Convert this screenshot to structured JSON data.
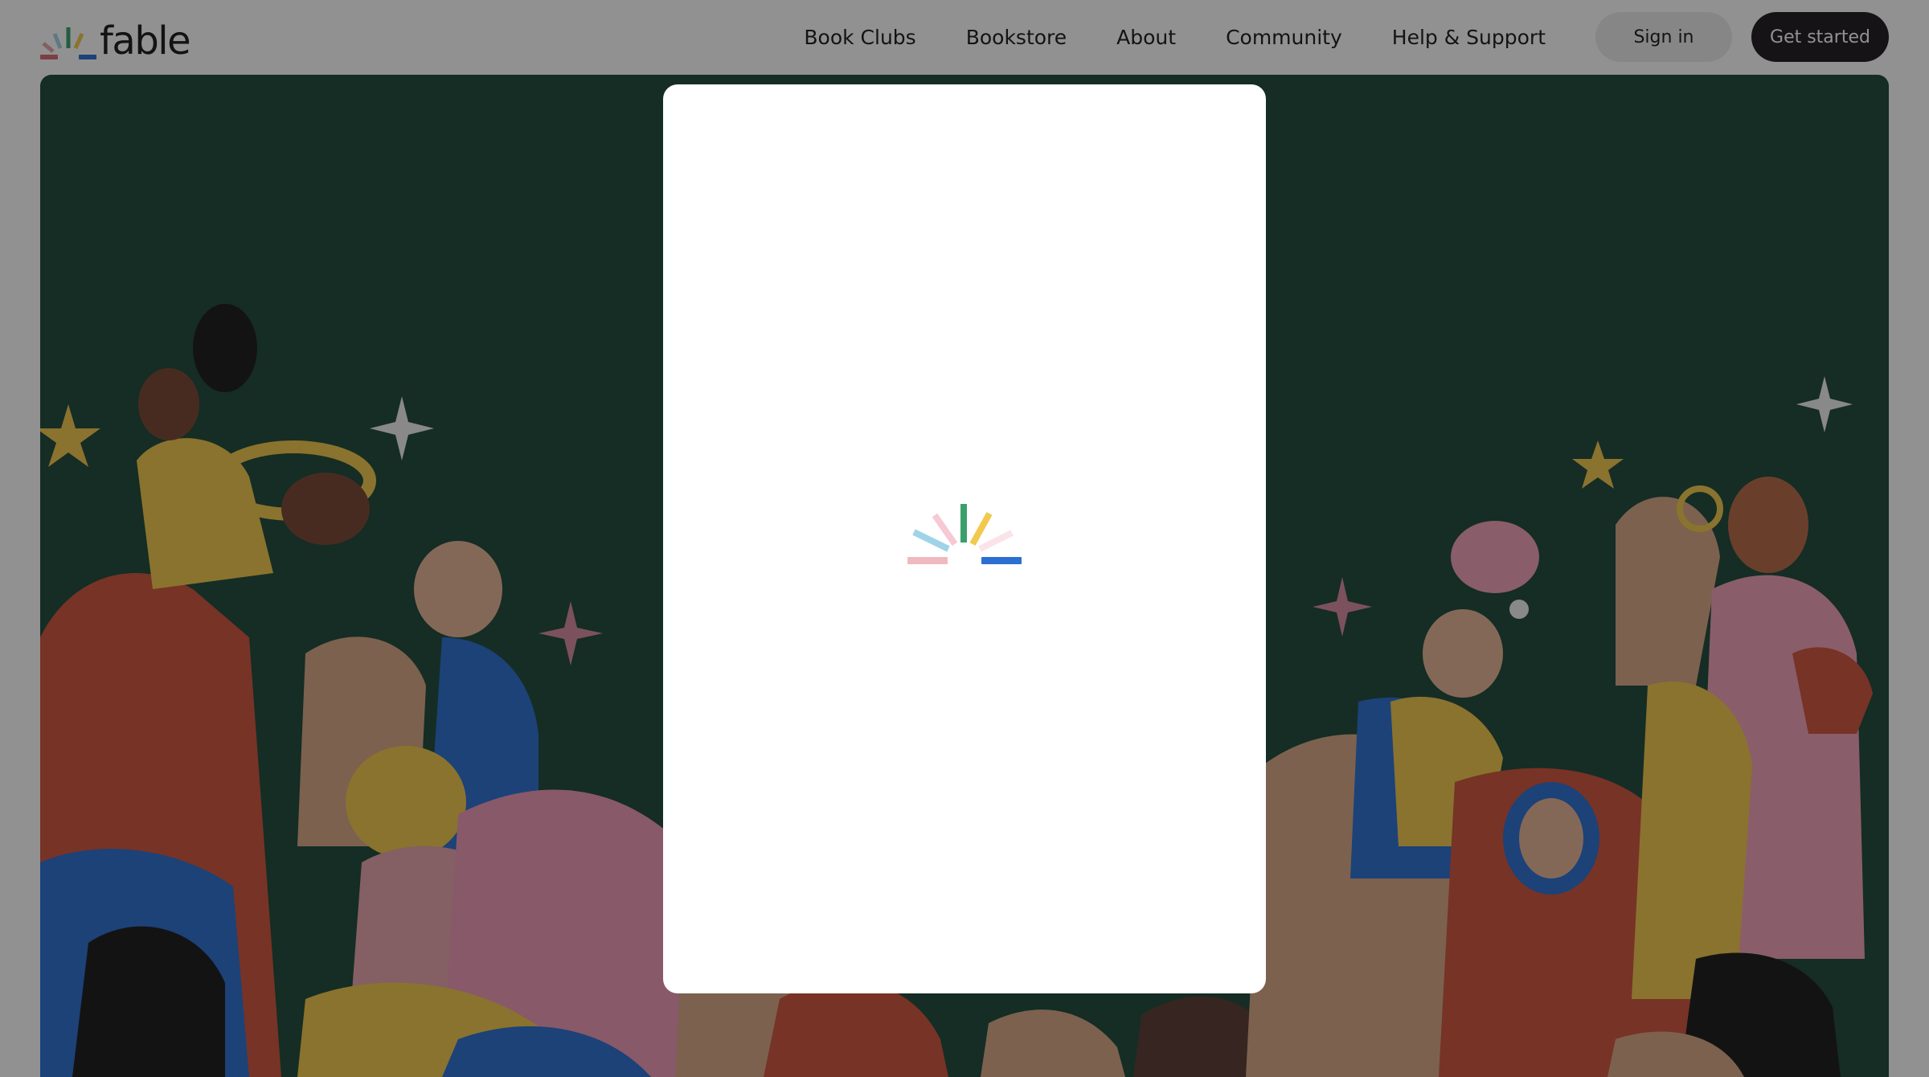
{
  "brand": {
    "name": "fable",
    "colors": [
      "#e8a4ab",
      "#9fd4e8",
      "#3aa06a",
      "#f2c94c",
      "#f7c3d0",
      "#2b6fd1"
    ]
  },
  "nav": {
    "links": [
      "Book Clubs",
      "Bookstore",
      "About",
      "Community",
      "Help & Support"
    ],
    "signin_label": "Sign in",
    "get_started_label": "Get started"
  },
  "hero": {
    "background": "#1e4a39"
  },
  "modal": {
    "state": "loading",
    "spinner_icon": "fable-spark-loader-icon"
  },
  "overlay": {
    "color": "#0a0a0a",
    "opacity": 0.45
  }
}
